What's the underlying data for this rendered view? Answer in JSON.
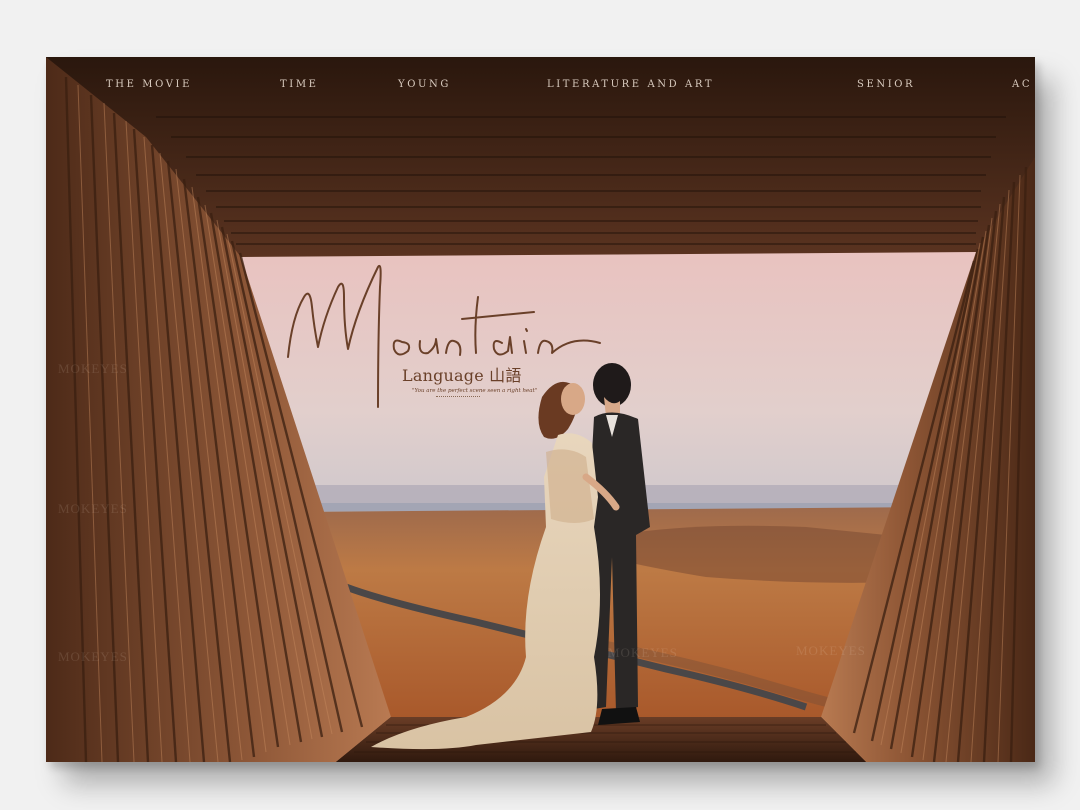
{
  "nav": {
    "items": [
      "THE MOVIE",
      "TIME",
      "YOUNG",
      "LITERATURE AND ART",
      "SENIOR",
      "AC"
    ]
  },
  "title": {
    "script": "Mountain",
    "subtitle": "Language 山語",
    "tagline": "\"You are the perfect scene seen a right heat\""
  },
  "watermarks": [
    "MOKEYES",
    "MOKEYES",
    "MOKEYES",
    "MOKEYES",
    "MOKEYES"
  ],
  "colors": {
    "frame_dark": "#2c1a10",
    "wood": "#9a6240",
    "sky_top": "#e7c4c0",
    "desert": "#b86f3c",
    "title_brown": "#6a4029"
  }
}
